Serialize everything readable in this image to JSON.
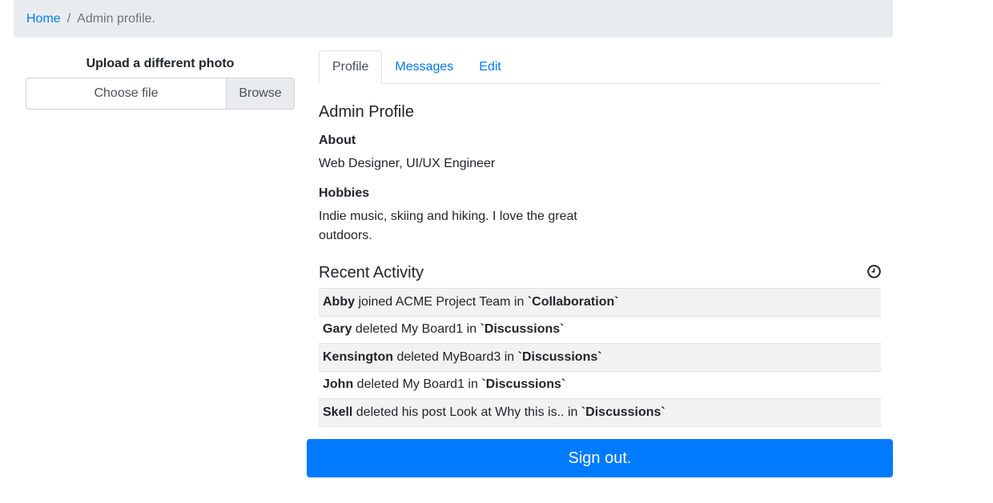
{
  "breadcrumb": {
    "home": "Home",
    "separator": "/",
    "current": "Admin profile."
  },
  "upload": {
    "title": "Upload a different photo",
    "file_label": "Choose file",
    "browse": "Browse"
  },
  "tabs": [
    {
      "label": "Profile",
      "active": true
    },
    {
      "label": "Messages",
      "active": false
    },
    {
      "label": "Edit",
      "active": false
    }
  ],
  "profile": {
    "heading": "Admin Profile",
    "about_label": "About",
    "about_text": "Web Designer, UI/UX Engineer",
    "hobbies_label": "Hobbies",
    "hobbies_line1": "Indie music, skiing and hiking. I love the great",
    "hobbies_line2": "outdoors."
  },
  "activity": {
    "heading": "Recent Activity",
    "icon": "clock-icon",
    "items": [
      {
        "user": "Abby",
        "action": " joined ACME Project Team in ",
        "place": "`Collaboration`"
      },
      {
        "user": "Gary",
        "action": " deleted My Board1 in ",
        "place": "`Discussions`"
      },
      {
        "user": "Kensington",
        "action": " deleted MyBoard3 in ",
        "place": "`Discussions`"
      },
      {
        "user": "John",
        "action": " deleted My Board1 in ",
        "place": "`Discussions`"
      },
      {
        "user": "Skell",
        "action": " deleted his post Look at Why this is.. in ",
        "place": "`Discussions`"
      }
    ]
  },
  "signout": "Sign out.",
  "colors": {
    "primary": "#007bff",
    "breadcrumb_bg": "#e9ecef",
    "stripe": "#f2f2f2"
  }
}
